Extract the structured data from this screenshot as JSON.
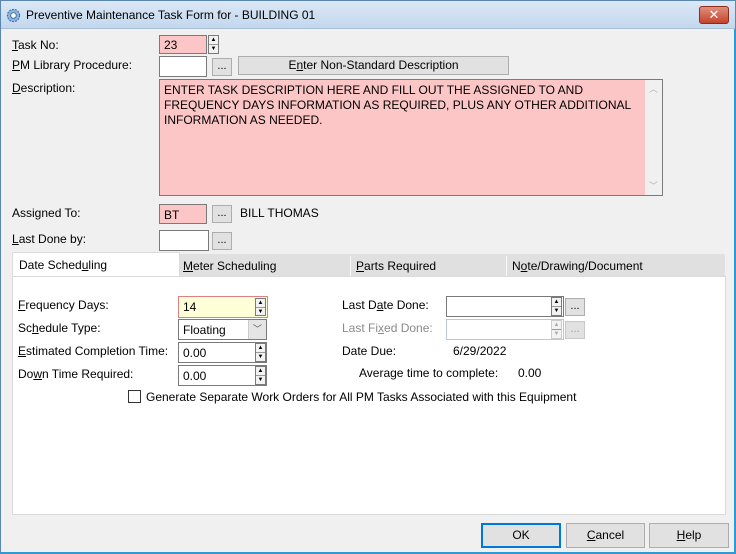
{
  "window": {
    "title": "Preventive Maintenance Task Form for - BUILDING 01",
    "icon": "gear-icon",
    "close_label": "✕"
  },
  "form": {
    "task_no": {
      "label_u": "T",
      "label_rest": "ask No:",
      "value": "23"
    },
    "pm_library": {
      "label_u": "P",
      "label_rest": "M Library Procedure:",
      "value": "",
      "browse": "..."
    },
    "non_standard_button": {
      "pre": "E",
      "u": "n",
      "post": "ter Non-Standard Description"
    },
    "description": {
      "label_u": "D",
      "label_rest": "escription:",
      "value": "ENTER TASK DESCRIPTION HERE AND FILL OUT THE ASSIGNED TO AND FREQUENCY DAYS INFORMATION AS REQUIRED, PLUS ANY OTHER ADDITIONAL INFORMATION AS NEEDED."
    },
    "assigned_to": {
      "label": "Assigned To:",
      "value": "BT",
      "browse": "...",
      "name": "BILL THOMAS"
    },
    "last_done_by": {
      "label_u": "L",
      "label_rest": "ast Done by:",
      "value": "",
      "browse": "..."
    }
  },
  "tabs": [
    {
      "pre": "Date Sched",
      "u": "u",
      "post": "ling",
      "active": true
    },
    {
      "pre": "",
      "u": "M",
      "post": "eter Scheduling",
      "active": false
    },
    {
      "pre": "",
      "u": "P",
      "post": "arts Required",
      "active": false
    },
    {
      "pre": "N",
      "u": "o",
      "post": "te/Drawing/Document",
      "active": false
    }
  ],
  "date_scheduling": {
    "frequency_days": {
      "label_u": "F",
      "label_rest": "requency Days:",
      "value": "14"
    },
    "schedule_type": {
      "label_pre": "Sc",
      "label_u": "h",
      "label_post": "edule Type:",
      "value": "Floating"
    },
    "est_completion": {
      "label_u": "E",
      "label_rest": "stimated Completion Time:",
      "value": "0.00"
    },
    "down_time": {
      "label_pre": "Do",
      "label_u": "w",
      "label_post": "n Time Required:",
      "value": "0.00"
    },
    "last_date_done": {
      "label_pre": "Last D",
      "label_u": "a",
      "label_post": "te Done:",
      "value": "",
      "browse": "..."
    },
    "last_fixed_done": {
      "label_pre": "Last Fi",
      "label_u": "x",
      "label_post": "ed Done:",
      "value": "",
      "browse": "..."
    },
    "date_due": {
      "label": "Date Due:",
      "value": "6/29/2022"
    },
    "avg_time": {
      "label": "Average time to complete:",
      "value": "0.00"
    },
    "generate_separate": {
      "label": "Generate Separate Work Orders for All PM Tasks Associated with this Equipment",
      "checked": false
    }
  },
  "buttons": {
    "ok": "OK",
    "cancel_u": "C",
    "cancel_rest": "ancel",
    "help_u": "H",
    "help_rest": "elp"
  },
  "colors": {
    "required_field": "#fcc6c6",
    "focused_field": "#ffffd8",
    "default_button_border": "#0078d7"
  }
}
